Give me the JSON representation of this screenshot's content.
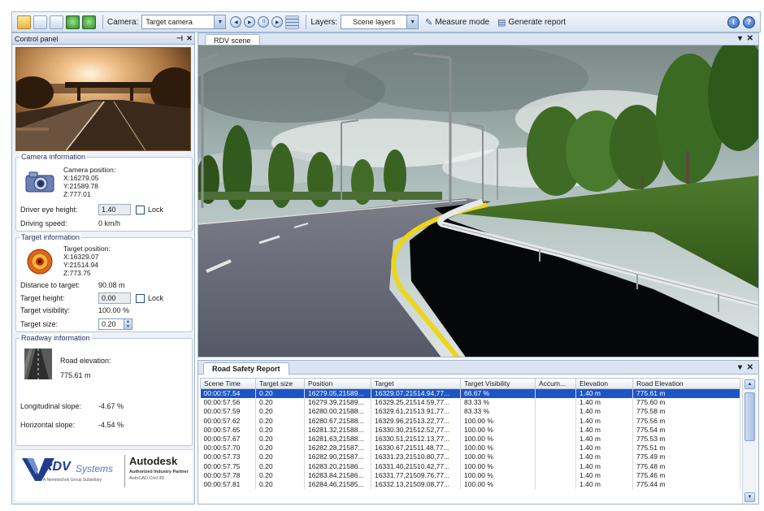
{
  "toolbar": {
    "camera_label": "Camera:",
    "camera_value": "Target camera",
    "layers_label": "Layers:",
    "layers_value": "Scene layers",
    "measure_label": "Measure mode",
    "report_label": "Generate report",
    "icons": [
      "open-folder-icon",
      "save-icon",
      "print-icon",
      "refresh-icon",
      "export-icon",
      "grid-icon",
      "ruler-icon",
      "report-icon",
      "help-icon",
      "info-icon"
    ]
  },
  "control_panel": {
    "title": "Control panel",
    "camera": {
      "title": "Camera information",
      "position_label": "Camera position:",
      "x": "X:16279.05",
      "y": "Y:21589.78",
      "z": "Z:777.01",
      "eye_height_label": "Driver eye height:",
      "eye_height_value": "1.40",
      "lock_label": "Lock",
      "speed_label": "Driving speed:",
      "speed_value": "0 km/h"
    },
    "target": {
      "title": "Target information",
      "position_label": "Target position:",
      "x": "X:16329.07",
      "y": "Y:21514.94",
      "z": "Z:773.75",
      "distance_label": "Distance to target:",
      "distance_value": "90.08 m",
      "height_label": "Target height:",
      "height_value": "0.00",
      "lock_label": "Lock",
      "visibility_label": "Target visibility:",
      "visibility_value": "100.00 %",
      "size_label": "Target size:",
      "size_value": "0.20"
    },
    "roadway": {
      "title": "Roadway information",
      "elevation_label": "Road elevation:",
      "elevation_value": "775.61 m",
      "long_slope_label": "Longitudinal slope:",
      "long_slope_value": "-4.67 %",
      "horiz_slope_label": "Horizontal slope:",
      "horiz_slope_value": "-4.54 %"
    },
    "logos": {
      "rdv": "RDV",
      "rdv_sub": "Systems",
      "rdv_tagline": "A Nemetschek Group Subsidiary",
      "autodesk": "Autodesk",
      "autodesk_line1": "Authorized Industry Partner",
      "autodesk_line2": "AutoCAD Civil 3D"
    }
  },
  "scene": {
    "tab": "RDV scene"
  },
  "report": {
    "tab": "Road Safety Report",
    "columns": [
      "Scene Time",
      "Target size",
      "Position",
      "Target",
      "Target Visibility",
      "Accum...",
      "Elevation",
      "Road Elevation"
    ],
    "rows": [
      [
        "00:00:57.54",
        "0.20",
        "16279.05,21589...",
        "16329.07,21514.94,77...",
        "66.67 %",
        "",
        "1.40 m",
        "775.61 m"
      ],
      [
        "00:00:57.56",
        "0.20",
        "16279.39,21589...",
        "16329.25,21514.59,77...",
        "83.33 %",
        "",
        "1.40 m",
        "775.60 m"
      ],
      [
        "00:00:57.59",
        "0.20",
        "16280.00,21588...",
        "16329.61,21513.91,77...",
        "83.33 %",
        "",
        "1.40 m",
        "775.58 m"
      ],
      [
        "00:00:57.62",
        "0.20",
        "16280.67,21588...",
        "16329.96,21513.22,77...",
        "100.00 %",
        "",
        "1.40 m",
        "775.56 m"
      ],
      [
        "00:00:57.65",
        "0.20",
        "16281.32,21588...",
        "16330.30,21512.52,77...",
        "100.00 %",
        "",
        "1.40 m",
        "775.54 m"
      ],
      [
        "00:00:57.67",
        "0.20",
        "16281.63,21588...",
        "16330.51,21512.13,77...",
        "100.00 %",
        "",
        "1.40 m",
        "775.53 m"
      ],
      [
        "00:00:57.70",
        "0.20",
        "16282.28,21587...",
        "16330.67,21511.48,77...",
        "100.00 %",
        "",
        "1.40 m",
        "775.51 m"
      ],
      [
        "00:00:57.73",
        "0.20",
        "16282.90,21587...",
        "16331.23,21510.80,77...",
        "100.00 %",
        "",
        "1.40 m",
        "775.49 m"
      ],
      [
        "00:00:57.75",
        "0.20",
        "16283.20,21586...",
        "16331.40,21510.42,77...",
        "100.00 %",
        "",
        "1.40 m",
        "775.48 m"
      ],
      [
        "00:00:57.78",
        "0.20",
        "16283.84,21586...",
        "16331.77,21509.76,77...",
        "100.00 %",
        "",
        "1.40 m",
        "775.46 m"
      ],
      [
        "00:00:57.81",
        "0.20",
        "16284.46,21585...",
        "16332.13,21509.08,77...",
        "100.00 %",
        "",
        "1.40 m",
        "775.44 m"
      ]
    ]
  }
}
